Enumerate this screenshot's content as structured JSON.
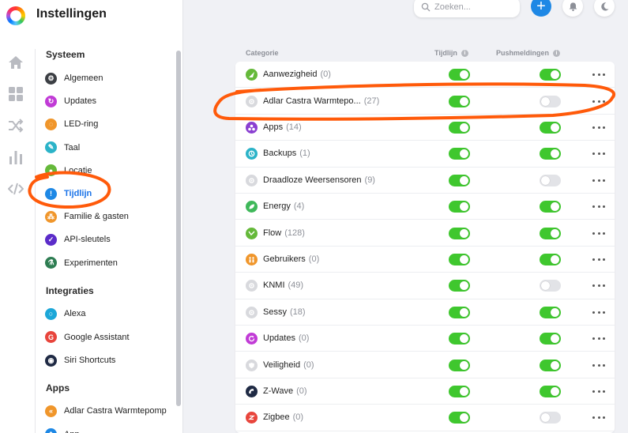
{
  "app": {
    "title": "Instellingen"
  },
  "rail": {
    "icons": [
      "home-icon",
      "devices-icon",
      "flow-icon",
      "insights-icon",
      "developer-icon"
    ]
  },
  "sidebar": {
    "sections": [
      {
        "title": "Systeem",
        "items": [
          {
            "label": "Algemeen",
            "icon": "gear-icon",
            "color": "#3c3f44",
            "active": false
          },
          {
            "label": "Updates",
            "icon": "refresh-icon",
            "color": "#c13bd6",
            "active": false
          },
          {
            "label": "LED-ring",
            "icon": "ledring-icon",
            "color": "#f0962b",
            "active": false
          },
          {
            "label": "Taal",
            "icon": "language-icon",
            "color": "#2bb3c8",
            "active": false
          },
          {
            "label": "Locatie",
            "icon": "location-icon",
            "color": "#65b93a",
            "active": false
          },
          {
            "label": "Tijdlijn",
            "icon": "timeline-icon",
            "color": "#1e88e5",
            "active": true
          },
          {
            "label": "Familie & gasten",
            "icon": "family-icon",
            "color": "#f0962b",
            "active": false
          },
          {
            "label": "API-sleutels",
            "icon": "key-icon",
            "color": "#5b2cc9",
            "active": false
          },
          {
            "label": "Experimenten",
            "icon": "flask-icon",
            "color": "#2e7d52",
            "active": false
          }
        ]
      },
      {
        "title": "Integraties",
        "items": [
          {
            "label": "Alexa",
            "icon": "alexa-icon",
            "color": "#1ca7d8",
            "active": false
          },
          {
            "label": "Google Assistant",
            "icon": "google-icon",
            "color": "#e8453c",
            "active": false
          },
          {
            "label": "Siri Shortcuts",
            "icon": "siri-icon",
            "color": "#1f2a44",
            "active": false
          }
        ]
      },
      {
        "title": "Apps",
        "items": [
          {
            "label": "Adlar Castra Warmtepomp",
            "icon": "adlar-icon",
            "color": "#f0962b",
            "active": false
          },
          {
            "label": "App",
            "icon": "app-icon",
            "color": "#1e88e5",
            "active": false
          }
        ]
      }
    ]
  },
  "toolbar": {
    "search_placeholder": "Zoeken...",
    "add_label": "+"
  },
  "table": {
    "headers": {
      "category": "Categorie",
      "timeline": "Tijdlijn",
      "push": "Pushmeldingen",
      "info": "i"
    },
    "rows": [
      {
        "name": "Aanwezigheid",
        "count": "(0)",
        "icon": "presence-icon",
        "color": "#65b93a",
        "timeline": true,
        "push": true
      },
      {
        "name": "Adlar Castra Warmtepo...",
        "count": "(27)",
        "icon": "device-icon",
        "color": "#d8d9dd",
        "timeline": true,
        "push": false
      },
      {
        "name": "Apps",
        "count": "(14)",
        "icon": "apps-icon",
        "color": "#8a3fd1",
        "timeline": true,
        "push": true
      },
      {
        "name": "Backups",
        "count": "(1)",
        "icon": "backup-icon",
        "color": "#2bb3c8",
        "timeline": true,
        "push": true
      },
      {
        "name": "Draadloze Weersensoren",
        "count": "(9)",
        "icon": "device-icon",
        "color": "#d8d9dd",
        "timeline": true,
        "push": false
      },
      {
        "name": "Energy",
        "count": "(4)",
        "icon": "energy-icon",
        "color": "#3fb85a",
        "timeline": true,
        "push": true
      },
      {
        "name": "Flow",
        "count": "(128)",
        "icon": "flow-icon",
        "color": "#65b93a",
        "timeline": true,
        "push": true
      },
      {
        "name": "Gebruikers",
        "count": "(0)",
        "icon": "users-icon",
        "color": "#f0962b",
        "timeline": true,
        "push": true
      },
      {
        "name": "KNMI",
        "count": "(49)",
        "icon": "device-icon",
        "color": "#d8d9dd",
        "timeline": true,
        "push": false
      },
      {
        "name": "Sessy",
        "count": "(18)",
        "icon": "device-icon",
        "color": "#d8d9dd",
        "timeline": true,
        "push": true
      },
      {
        "name": "Updates",
        "count": "(0)",
        "icon": "refresh-icon",
        "color": "#c13bd6",
        "timeline": true,
        "push": true
      },
      {
        "name": "Veiligheid",
        "count": "(0)",
        "icon": "shield-icon",
        "color": "#d8d9dd",
        "timeline": true,
        "push": true
      },
      {
        "name": "Z-Wave",
        "count": "(0)",
        "icon": "zwave-icon",
        "color": "#1f2a44",
        "timeline": true,
        "push": true
      },
      {
        "name": "Zigbee",
        "count": "(0)",
        "icon": "zigbee-icon",
        "color": "#e8453c",
        "timeline": true,
        "push": false
      }
    ]
  },
  "colors": {
    "toggle_on": "#3fc72e",
    "toggle_off": "#e2e3e7",
    "accent": "#1e88e5",
    "annotation": "#ff5a0a"
  }
}
